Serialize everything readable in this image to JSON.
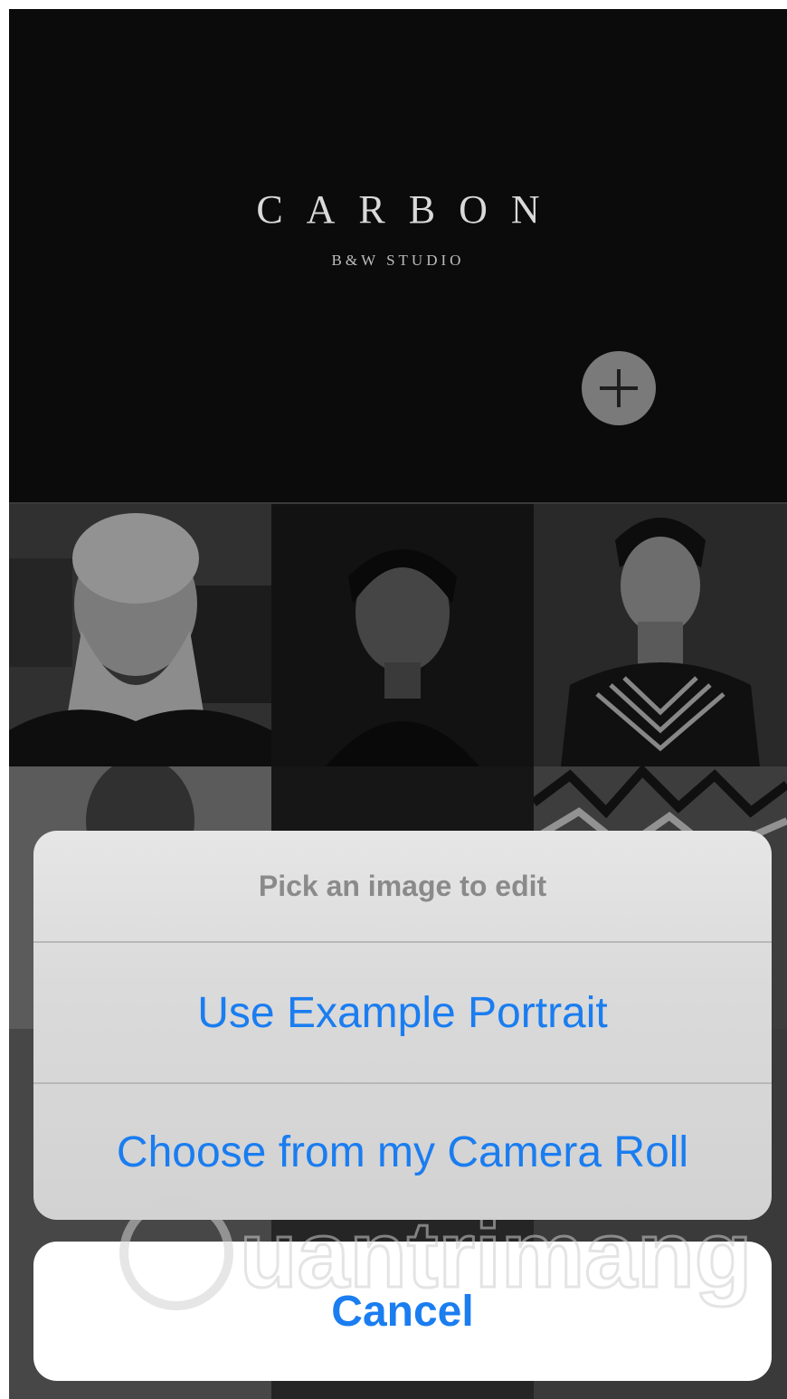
{
  "app": {
    "title": "CARBON",
    "subtitle": "B&W STUDIO"
  },
  "header": {
    "add_icon": "plus-icon"
  },
  "gallery": {
    "tiles": [
      {
        "name": "portrait-bearded-man",
        "tone": "#8a8a8a"
      },
      {
        "name": "portrait-woman",
        "tone": "#1b1b1b"
      },
      {
        "name": "portrait-man-bodypaint",
        "tone": "#3c3c3c"
      },
      {
        "name": "portrait-man-2",
        "tone": "#7d7d7d"
      },
      {
        "name": "portrait-dark",
        "tone": "#222222"
      },
      {
        "name": "portrait-tiger",
        "tone": "#6a6a6a"
      }
    ]
  },
  "action_sheet": {
    "title": "Pick an image to edit",
    "options": [
      {
        "label": "Use Example Portrait"
      },
      {
        "label": "Choose from my Camera Roll"
      }
    ],
    "cancel_label": "Cancel"
  },
  "colors": {
    "accent": "#1a7df0",
    "background": "#0b0b0b"
  },
  "watermark": {
    "text": "Quantrimang"
  }
}
